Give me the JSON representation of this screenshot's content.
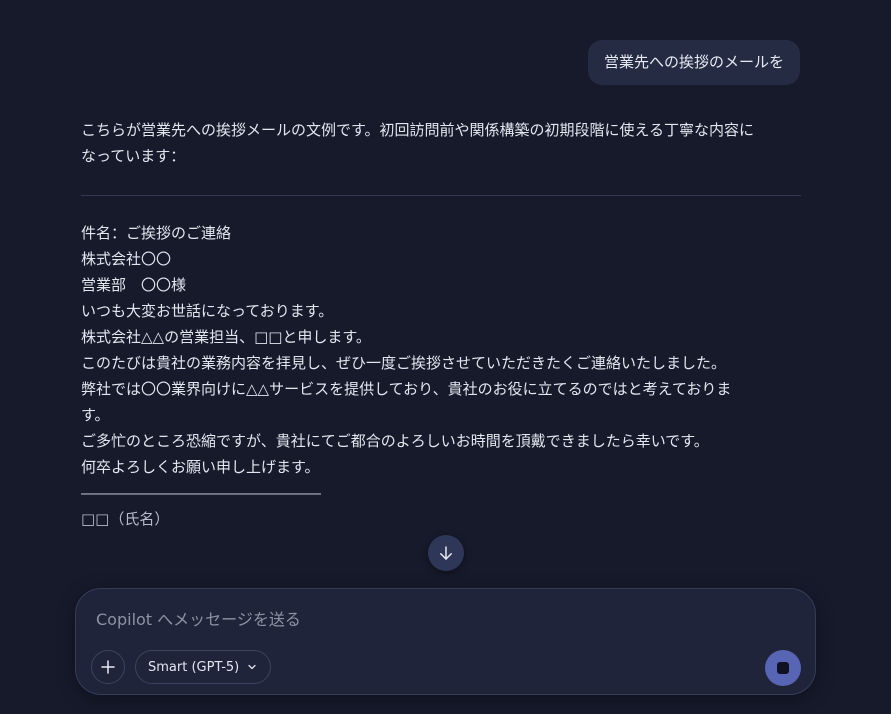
{
  "user_message": {
    "text": "営業先への挨拶のメールを"
  },
  "assistant_message": {
    "intro_lines": [
      "こちらが営業先への挨拶メールの文例です。初回訪問前や関係構築の初期段階に使える丁寧な内容に",
      "なっています："
    ],
    "subject": "件名：ご挨拶のご連絡",
    "recipient_lines": [
      "株式会社〇〇",
      "営業部　〇〇様"
    ],
    "greeting_lines": [
      "いつも大変お世話になっております。",
      "株式会社△△の営業担当、□□と申します。"
    ],
    "body_lines": [
      "このたびは貴社の業務内容を拝見し、ぜひ一度ご挨拶させていただきたくご連絡いたしました。",
      "弊社では〇〇業界向けに△△サービスを提供しており、貴社のお役に立てるのではと考えておりま",
      "す。"
    ],
    "closing_lines": [
      "ご多忙のところ恐縮ですが、貴社にてご都合のよろしいお時間を頂戴できましたら幸いです。",
      "何卒よろしくお願い申し上げます。"
    ],
    "signature_rule": "――――――――――――――――",
    "signature_name": "□□（氏名）"
  },
  "composer": {
    "placeholder": "Copilot へメッセージを送る",
    "value": "",
    "model_label": "Smart (GPT-5)"
  },
  "icons": {
    "scroll_down": "arrow-down-icon",
    "add": "plus-icon",
    "model_dropdown": "chevron-down-icon",
    "stop": "stop-icon"
  },
  "colors": {
    "background": "#161a2b",
    "user_bubble": "#252b42",
    "composer_bg": "#1f243a",
    "accent": "#5865b5"
  }
}
